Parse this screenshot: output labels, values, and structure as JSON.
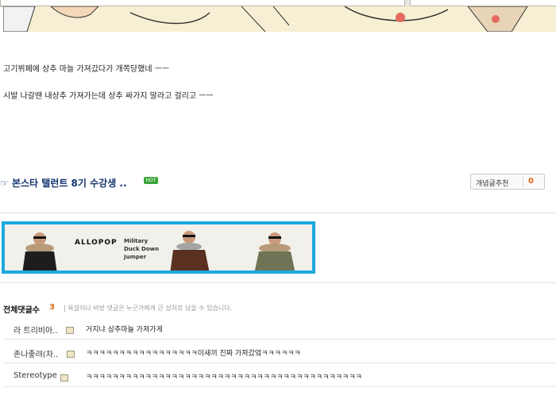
{
  "post": {
    "line1": "고기뷔페에 상추 마늘 가져갔다가 개쪽당했네 ㅡㅡ",
    "line2": "시발 나갈땐 내상추 가져가는데 상추 싸가지 말라고 걸리고 ㅡㅡ"
  },
  "next_post": {
    "icon": "☞",
    "title": "본스타 탤런트 8기 수강생 ..",
    "badge": "HOT",
    "recommend_label": "개념글추천",
    "recommend_count": "0"
  },
  "ad": {
    "brand": "ALLOPOP",
    "lines": [
      "Military",
      "Duck Down",
      "Jumper"
    ],
    "border_color": "#1da8dd"
  },
  "comments": {
    "title": "전체댓글수",
    "count": "3",
    "note": "| 욕설이나 비방 댓글은 누군가에게 큰 상처로 남을 수 있습니다.",
    "items": [
      {
        "nick": "라 트리비아..",
        "text": "거지냐 상추마늘 가져가게"
      },
      {
        "nick": "존나좋려(차..",
        "text": "ㅋㅋㅋㅋㅋㅋㅋㅋㅋㅋㅋㅋㅋㅋㅋㅋㅋ이새끼 진짜 가져갔엌ㅋㅋㅋㅋㅋㅋ"
      },
      {
        "nick": "Stereotype",
        "text": "ㅋㅋㅋㅋㅋㅋㅋㅋㅋㅋㅋㅋㅋㅋㅋㅋㅋㅋㅋㅋㅋㅋㅋㅋㅋㅋㅋㅋㅋㅋㅋㅋㅋㅋㅋㅋㅋㅋㅋㅋㅋㅋ"
      }
    ]
  }
}
